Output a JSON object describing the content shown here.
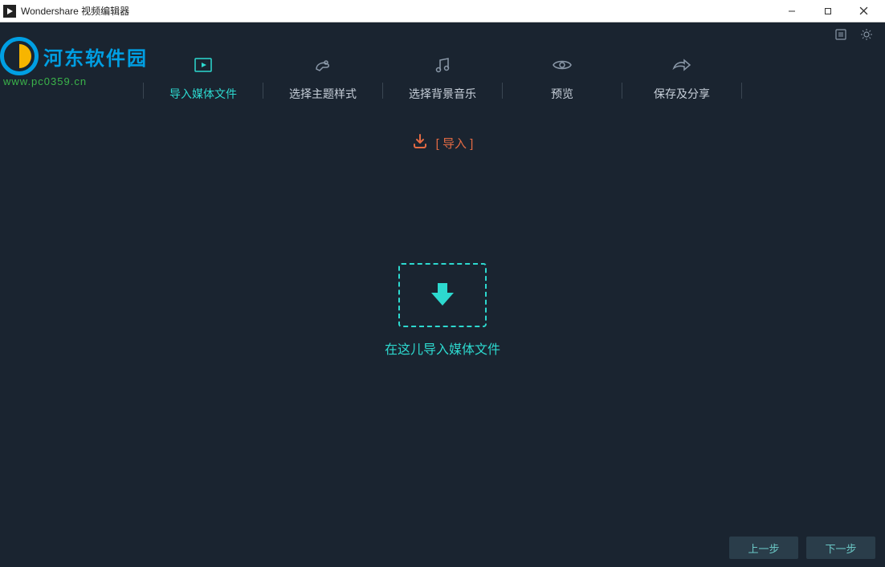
{
  "titlebar": {
    "title": "Wondershare 视频编辑器"
  },
  "watermark": {
    "text": "河东软件园",
    "url": "www.pc0359.cn"
  },
  "steps": [
    {
      "label": "导入媒体文件"
    },
    {
      "label": "选择主题样式"
    },
    {
      "label": "选择背景音乐"
    },
    {
      "label": "预览"
    },
    {
      "label": "保存及分享"
    }
  ],
  "import": {
    "label": "[ 导入 ]"
  },
  "dropzone": {
    "label": "在这儿导入媒体文件"
  },
  "footer": {
    "prev": "上一步",
    "next": "下一步"
  }
}
